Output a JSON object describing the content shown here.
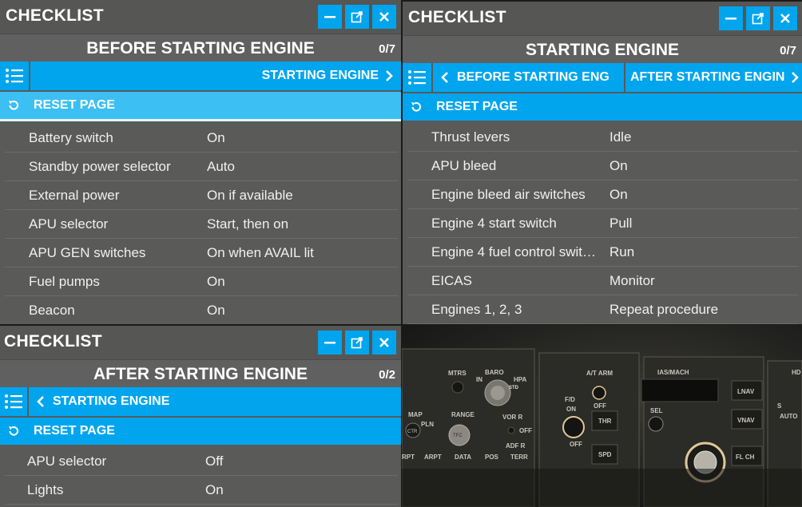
{
  "panels": [
    {
      "title": "CHECKLIST",
      "section": "BEFORE STARTING ENGINE",
      "count": "0/7",
      "next_label": "STARTING ENGINE",
      "reset_label": "RESET PAGE",
      "items": [
        {
          "item": "Battery switch",
          "value": "On"
        },
        {
          "item": "Standby power selector",
          "value": "Auto"
        },
        {
          "item": "External power",
          "value": "On if available"
        },
        {
          "item": "APU selector",
          "value": "Start, then on"
        },
        {
          "item": "APU GEN switches",
          "value": "On when AVAIL lit"
        },
        {
          "item": "Fuel pumps",
          "value": "On"
        },
        {
          "item": "Beacon",
          "value": "On"
        }
      ]
    },
    {
      "title": "CHECKLIST",
      "section": "STARTING ENGINE",
      "count": "0/7",
      "prev_label": "BEFORE STARTING ENG",
      "next_label": "AFTER STARTING ENGIN",
      "reset_label": "RESET PAGE",
      "items": [
        {
          "item": "Thrust levers",
          "value": "Idle"
        },
        {
          "item": "APU bleed",
          "value": "On"
        },
        {
          "item": "Engine bleed air switches",
          "value": "On"
        },
        {
          "item": "Engine 4 start switch",
          "value": "Pull"
        },
        {
          "item": "Engine 4 fuel control swit…",
          "value": "Run"
        },
        {
          "item": "EICAS",
          "value": "Monitor"
        },
        {
          "item": "Engines 1, 2, 3",
          "value": "Repeat procedure"
        }
      ]
    },
    {
      "title": "CHECKLIST",
      "section": "AFTER STARTING ENGINE",
      "count": "0/2",
      "prev_label": "STARTING ENGINE",
      "reset_label": "RESET PAGE",
      "items": [
        {
          "item": "APU selector",
          "value": "Off"
        },
        {
          "item": "Lights",
          "value": "On"
        }
      ]
    }
  ],
  "cockpit": {
    "labels": [
      "MTRS",
      "BARO",
      "STD",
      "MAP",
      "PLN",
      "CTR",
      "RANGE",
      "TFC",
      "VOR R",
      "OFF",
      "ADF R",
      "RPT",
      "ARPT",
      "DATA",
      "POS",
      "TERR",
      "A/T ARM",
      "OFF",
      "F/D",
      "ON",
      "OFF",
      "THR",
      "SPD",
      "IAS/MACH",
      "SEL",
      "LNAV",
      "VNAV",
      "FL CH",
      "AUTO",
      "S",
      "IN",
      "HPA",
      "HD"
    ]
  },
  "colors": {
    "accent": "#00a5ee",
    "panel": "#5a5a58",
    "text": "#ffffff"
  }
}
